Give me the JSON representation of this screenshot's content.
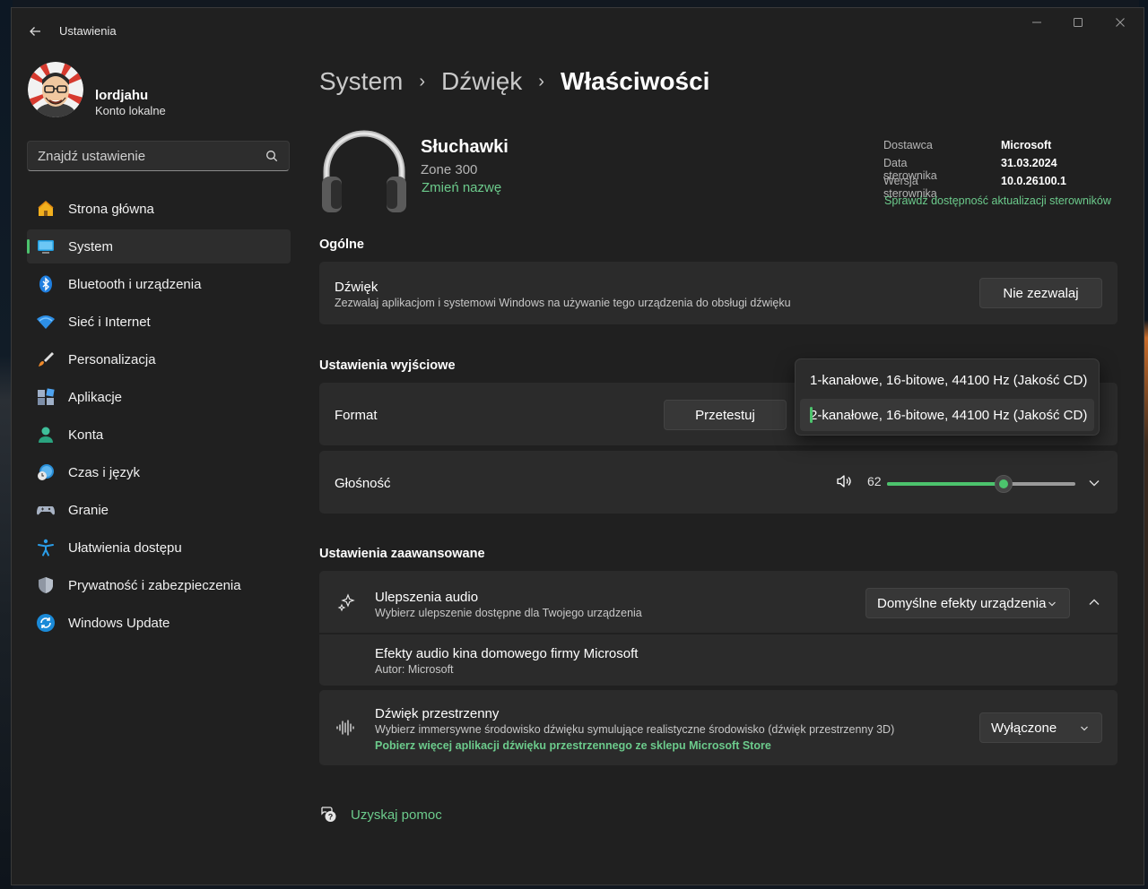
{
  "window": {
    "title": "Ustawienia"
  },
  "user": {
    "name": "lordjahu",
    "account_type": "Konto lokalne"
  },
  "search": {
    "placeholder": "Znajdź ustawienie"
  },
  "nav": [
    {
      "label": "Strona główna",
      "icon": "home-icon",
      "active": false
    },
    {
      "label": "System",
      "icon": "system-icon",
      "active": true
    },
    {
      "label": "Bluetooth i urządzenia",
      "icon": "bluetooth-icon",
      "active": false
    },
    {
      "label": "Sieć i Internet",
      "icon": "wifi-icon",
      "active": false
    },
    {
      "label": "Personalizacja",
      "icon": "brush-icon",
      "active": false
    },
    {
      "label": "Aplikacje",
      "icon": "apps-icon",
      "active": false
    },
    {
      "label": "Konta",
      "icon": "accounts-icon",
      "active": false
    },
    {
      "label": "Czas i język",
      "icon": "time-language-icon",
      "active": false
    },
    {
      "label": "Granie",
      "icon": "gamepad-icon",
      "active": false
    },
    {
      "label": "Ułatwienia dostępu",
      "icon": "accessibility-icon",
      "active": false
    },
    {
      "label": "Prywatność i zabezpieczenia",
      "icon": "shield-icon",
      "active": false
    },
    {
      "label": "Windows Update",
      "icon": "windows-update-icon",
      "active": false
    }
  ],
  "breadcrumb": {
    "level1": "System",
    "level2": "Dźwięk",
    "current": "Właściwości"
  },
  "device": {
    "name": "Słuchawki",
    "model": "Zone 300",
    "rename_link": "Zmień nazwę",
    "info": {
      "provider_label": "Dostawca",
      "provider_value": "Microsoft",
      "driver_date_label": "Data sterownika",
      "driver_date_value": "31.03.2024",
      "driver_version_label": "Wersja sterownika",
      "driver_version_value": "10.0.26100.1",
      "update_link": "Sprawdź dostępność aktualizacji sterowników"
    }
  },
  "general": {
    "heading": "Ogólne",
    "audio": {
      "title": "Dźwięk",
      "subtitle": "Zezwalaj aplikacjom i systemowi Windows na używanie tego urządzenia do obsługi dźwięku",
      "button": "Nie zezwalaj"
    }
  },
  "output": {
    "heading": "Ustawienia wyjściowe",
    "format": {
      "label": "Format",
      "test_button": "Przetestuj",
      "options": [
        "1-kanałowe, 16-bitowe, 44100 Hz (Jakość CD)",
        "2-kanałowe, 16-bitowe, 44100 Hz (Jakość CD)"
      ],
      "selected_index": 1
    },
    "volume": {
      "label": "Głośność",
      "value": "62",
      "fraction": 0.62
    }
  },
  "advanced": {
    "heading": "Ustawienia zaawansowane",
    "enhancements": {
      "title": "Ulepszenia audio",
      "subtitle": "Wybierz ulepszenie dostępne dla Twojego urządzenia",
      "select_value": "Domyślne efekty urządzenia"
    },
    "effect": {
      "title": "Efekty audio kina domowego firmy Microsoft",
      "author": "Autor: Microsoft"
    },
    "spatial": {
      "title": "Dźwięk przestrzenny",
      "subtitle": "Wybierz immersywne środowisko dźwięku symulujące realistyczne środowisko (dźwięk przestrzenny 3D)",
      "store_link": "Pobierz więcej aplikacji dźwięku przestrzennego ze sklepu Microsoft Store",
      "select_value": "Wyłączone"
    }
  },
  "help": {
    "label": "Uzyskaj pomoc"
  },
  "colors": {
    "accent": "#4cc36d",
    "link": "#6ccb8c",
    "background": "#202020",
    "card": "#2b2b2b"
  }
}
